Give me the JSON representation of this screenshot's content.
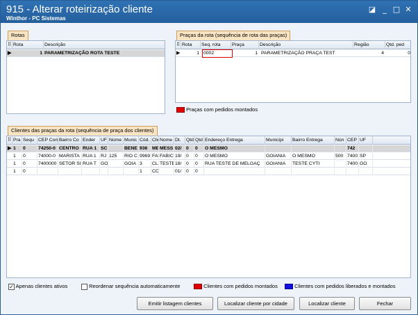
{
  "window": {
    "title": "915 - Alterar roteirização cliente",
    "subtitle": "Winthor - PC Sistemas",
    "controls": [
      "◪",
      "_",
      "□",
      "✕"
    ]
  },
  "rotas": {
    "tab": "Rotas",
    "headers": [
      "Rota",
      "Descrição"
    ],
    "rows": [
      [
        "1",
        "PARAMETRIZAÇÃO ROTA TESTE"
      ]
    ]
  },
  "pracas": {
    "tab": "Praças da rota (sequência de rota das praças)",
    "headers": [
      "Rota",
      "Seq. rota",
      "Praça",
      "Descrição",
      "Região",
      "Qtd. ped"
    ],
    "rows": [
      [
        "1",
        "0002",
        "1",
        "PARAMETRIZAÇÃO PRAÇA TEST",
        "4",
        "0"
      ]
    ],
    "legend": "Praças com pedidos montados"
  },
  "clientes": {
    "tab": "Clientes das praças da rota (sequência de praça dos clientes)",
    "headers": [
      "Pra",
      "Sequ",
      "CEP Com",
      "Bairro Co",
      "Ender",
      "UF",
      "Núme",
      "Munic",
      "Cód.",
      "Clie",
      "Nome",
      "Dt.",
      "Qtd",
      "Qtd",
      "Endereço Entrega",
      "Municípi",
      "Bairro Entrega",
      "Nún",
      "CEP",
      "UF"
    ],
    "rows": [
      [
        "1",
        "0",
        "74250-0",
        "CENTRO",
        "RUA 1",
        "SC",
        "",
        "BENE",
        "936",
        "ME",
        "MESS",
        "02/",
        "0",
        "0",
        "O MESMO",
        "",
        "",
        "",
        "742",
        ""
      ],
      [
        "1",
        "0",
        "74000-0",
        "MARISTA",
        "RUA 1",
        "RJ",
        "125",
        "RIO C",
        "9969",
        "FAB",
        "FABIC",
        "19/",
        "0",
        "0",
        "O MESMO",
        "GOIANIA",
        "O MESMO",
        "500",
        "7400",
        "SP"
      ],
      [
        "1",
        "0",
        "7400000",
        "SETOR SI",
        "RUA T",
        "GO",
        "",
        "GOIA",
        "3",
        "CLI",
        "TESTE",
        "18/",
        "0",
        "0",
        "RUA TESTE DE MELGAÇ",
        "GOIANIA",
        "TESTE CYTI",
        "",
        "7400",
        "GO"
      ],
      [
        "1",
        "0",
        "",
        "",
        "",
        "",
        "",
        "",
        "1",
        "CON",
        "",
        "01/",
        "0",
        "0",
        "",
        "",
        "",
        "",
        "",
        ""
      ]
    ]
  },
  "footer": {
    "apenas_ativos": "Apenas clientes ativos",
    "reordenar": "Reordenar sequência automaticamente",
    "montados": "Clientes com pedidos montados",
    "liberados": "Clientes com pedidos liberados e montados",
    "btn_emitir": "Emitir listagem clientes",
    "btn_localizar_cidade": "Localizar cliente por cidade",
    "btn_localizar": "Localizar cliente",
    "btn_fechar": "Fechar"
  },
  "colors": {
    "titlebar": "#2f72b4",
    "red": "#e00000",
    "blue": "#1010e0",
    "tab": "#f8e4c2"
  }
}
